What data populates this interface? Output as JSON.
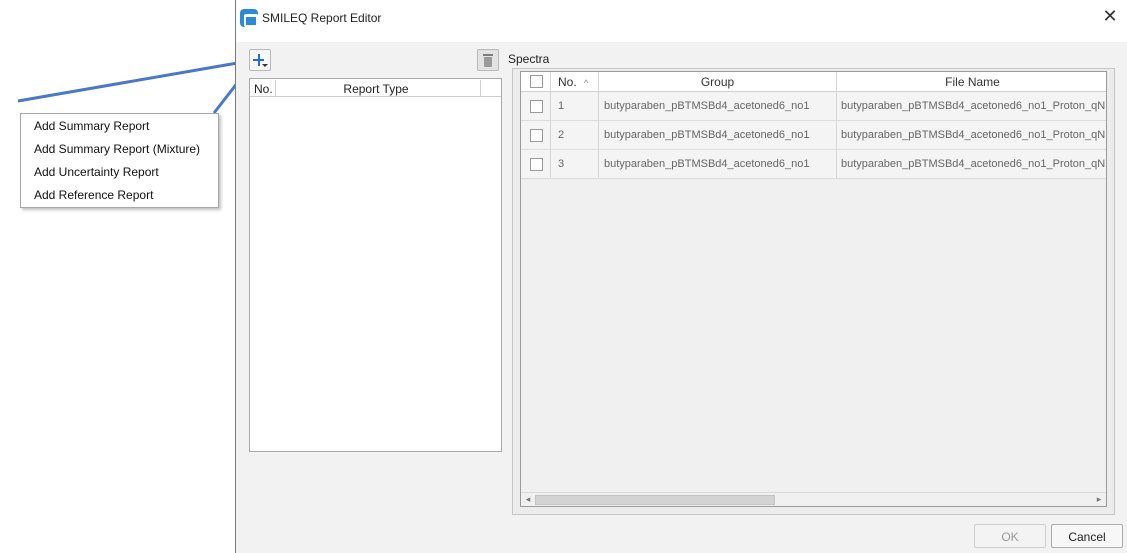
{
  "window": {
    "title": "SMILEQ Report Editor",
    "close_glyph": "✕"
  },
  "toolbar": {
    "add_icon": "plus-dropdown-icon",
    "delete_icon": "trash-icon"
  },
  "report_list": {
    "columns": [
      "No.",
      "Report Type"
    ],
    "rows": []
  },
  "spectra": {
    "label": "Spectra",
    "columns": {
      "no": "No.",
      "sort_glyph": "^",
      "group": "Group",
      "file_name": "File Name"
    },
    "rows": [
      {
        "no": "1",
        "group": "butyparaben_pBTMSBd4_acetoned6_no1",
        "file_name": "butyparaben_pBTMSBd4_acetoned6_no1_Proton_qN"
      },
      {
        "no": "2",
        "group": "butyparaben_pBTMSBd4_acetoned6_no1",
        "file_name": "butyparaben_pBTMSBd4_acetoned6_no1_Proton_qN"
      },
      {
        "no": "3",
        "group": "butyparaben_pBTMSBd4_acetoned6_no1",
        "file_name": "butyparaben_pBTMSBd4_acetoned6_no1_Proton_qN"
      }
    ],
    "scroll_left": "◂",
    "scroll_right": "▸"
  },
  "buttons": {
    "ok": "OK",
    "cancel": "Cancel"
  },
  "add_menu": {
    "items": [
      "Add Summary Report",
      "Add Summary Report (Mixture)",
      "Add Uncertainty Report",
      "Add Reference Report"
    ]
  },
  "colors": {
    "accent": "#1f6fd6",
    "callout_line": "#4a78c8"
  }
}
